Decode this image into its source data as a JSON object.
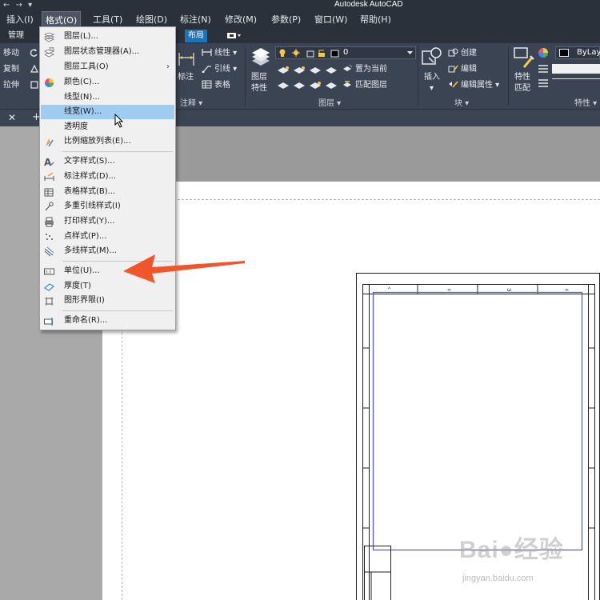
{
  "title_bar": {
    "quick_access": "← → ▾",
    "app_title": "Autodesk AutoCAD"
  },
  "menubar": {
    "items": [
      "插入(I)",
      "格式(O)",
      "工具(T)",
      "绘图(D)",
      "标注(N)",
      "修改(M)",
      "参数(P)",
      "窗口(W)",
      "帮助(H)"
    ],
    "active": "格式(O)"
  },
  "ribbon_tabs": {
    "items": [
      "管理",
      "布局"
    ],
    "highlighted": "布局"
  },
  "ribbon": {
    "modify": {
      "move": "移动",
      "copy": "复制",
      "stretch": "拉伸"
    },
    "annotation": {
      "dimension": "标注",
      "linear": "线性",
      "leader": "引线",
      "table": "表格",
      "panel_title": "注释 ▾"
    },
    "layers": {
      "layer_properties_line1": "图层",
      "layer_properties_line2": "特性",
      "current_layer": "0",
      "set_current": "置为当前",
      "match_layer": "匹配图层",
      "panel_title": "图层 ▾"
    },
    "block": {
      "insert": "插入",
      "create": "创建",
      "edit": "编辑",
      "edit_attributes": "编辑属性 ▾",
      "panel_title": "块 ▾"
    },
    "properties": {
      "match_line1": "特性",
      "match_line2": "匹配",
      "bylayer": "ByLay",
      "panel_title": "特性 ▾"
    }
  },
  "doc_tabs": {
    "close": "✕",
    "new": "+"
  },
  "format_menu": {
    "items": [
      {
        "label": "图层(L)...",
        "icon": "layer-icon"
      },
      {
        "label": "图层状态管理器(A)...",
        "icon": "layer-state-icon"
      },
      {
        "label": "图层工具(O)",
        "icon": "none",
        "submenu": true
      },
      {
        "label": "颜色(C)...",
        "icon": "color-wheel-icon"
      },
      {
        "label": "线型(N)...",
        "icon": "none"
      },
      {
        "label": "线宽(W)...",
        "icon": "none",
        "selected": true
      },
      {
        "label": "透明度",
        "icon": "none"
      },
      {
        "label": "比例缩放列表(E)...",
        "icon": "scale-list-icon"
      },
      {
        "label": "文字样式(S)...",
        "icon": "text-style-icon"
      },
      {
        "label": "标注样式(D)...",
        "icon": "dim-style-icon"
      },
      {
        "label": "表格样式(B)...",
        "icon": "table-style-icon"
      },
      {
        "label": "多重引线样式(I)",
        "icon": "mleader-style-icon"
      },
      {
        "label": "打印样式(Y)...",
        "icon": "plot-style-icon"
      },
      {
        "label": "点样式(P)...",
        "icon": "point-style-icon"
      },
      {
        "label": "多线样式(M)...",
        "icon": "mline-style-icon"
      },
      {
        "label": "单位(U)...",
        "icon": "units-icon"
      },
      {
        "label": "厚度(T)",
        "icon": "thickness-icon"
      },
      {
        "label": "图形界限(I)",
        "icon": "limits-icon"
      },
      {
        "label": "重命名(R)...",
        "icon": "rename-icon"
      }
    ],
    "submenu_arrow": "›"
  },
  "watermark": {
    "logo_text": "Bai●经验",
    "url": "jingyan.baidu.com"
  },
  "colors": {
    "chrome": "#2b313b",
    "ribbon": "#3b4453",
    "menu_bg": "#f0f0f0",
    "menu_selected": "#9fcdf2",
    "tab_highlight": "#1d72b8",
    "arrow_orange": "#f0562a",
    "frame_blue": "#5a5ad6"
  }
}
